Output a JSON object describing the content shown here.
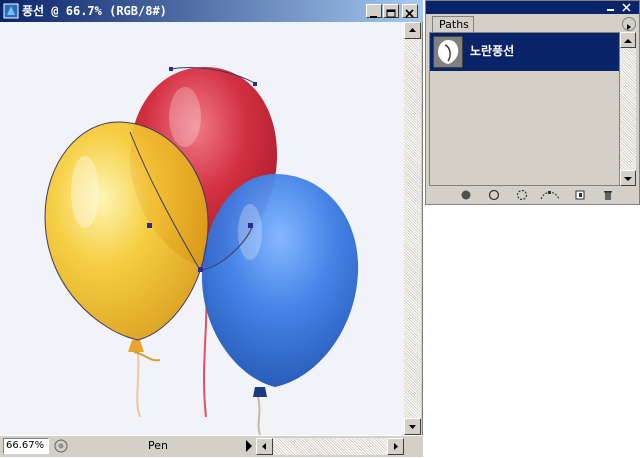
{
  "document": {
    "title": "풍선 @ 66.7% (RGB/8#)",
    "zoom": "66.67%",
    "tool": "Pen"
  },
  "window_buttons": [
    "minimize",
    "maximize",
    "close"
  ],
  "panel": {
    "tab": "Paths",
    "items": [
      {
        "label": "노란풍선",
        "selected": true
      }
    ],
    "footer_icons": [
      "fill-path-icon",
      "stroke-path-icon",
      "load-selection-icon",
      "make-work-path-icon",
      "new-path-icon",
      "delete-path-icon"
    ]
  },
  "colors": {
    "titlebar_start": "#0a246a",
    "titlebar_end": "#a6caf0",
    "selection": "#0a246a",
    "chrome": "#d4d0c8",
    "canvas": "#f1f3f8"
  }
}
